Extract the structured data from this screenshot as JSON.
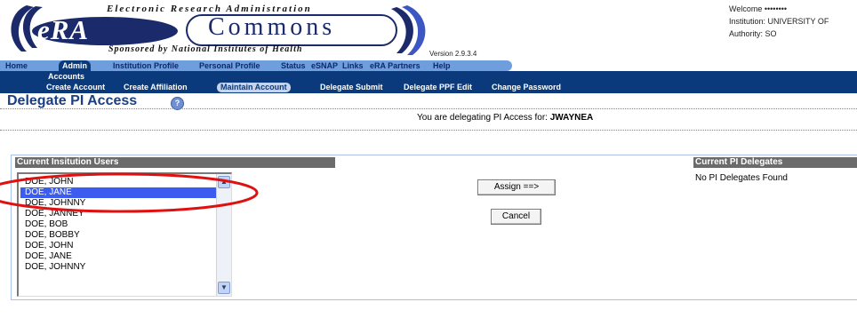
{
  "header": {
    "tagline_top": "Electronic Research Administration",
    "logo_era": "eRA",
    "logo_commons": "Commons",
    "tagline_bottom": "Sponsored by National Institutes of Health",
    "version": "Version 2.9.3.4"
  },
  "user_info": {
    "welcome": "Welcome  ••••••••",
    "institution": "Institution: UNIVERSITY OF",
    "authority": "Authority:  SO"
  },
  "nav": {
    "items": [
      "Home",
      "Admin",
      "Institution Profile",
      "Personal Profile",
      "Status",
      "eSNAP",
      "Links",
      "eRA Partners",
      "Help"
    ],
    "active": "Admin"
  },
  "subnav": {
    "section": "Accounts",
    "items": [
      "Create Account",
      "Create Affiliation",
      "Maintain Account",
      "Delegate Submit",
      "Delegate PPF Edit",
      "Change Password"
    ],
    "active": "Maintain Account"
  },
  "page": {
    "title": "Delegate PI Access",
    "help_glyph": "?",
    "delegating_prefix": "You are delegating PI Access for: ",
    "delegating_user": "JWAYNEA"
  },
  "users_panel": {
    "header": "Current Insitution Users",
    "users": [
      "DOE, JOHN",
      "DOE, JANE",
      "DOE, JOHNNY",
      "DOE, JANNEY",
      "DOE, BOB",
      "DOE, BOBBY",
      "DOE, JOHN",
      "DOE, JANE",
      "DOE, JOHNNY"
    ],
    "selected": "DOE, JANE"
  },
  "actions": {
    "assign_label": "Assign ==>",
    "cancel_label": "Cancel"
  },
  "delegates_panel": {
    "header": "Current PI Delegates",
    "empty_text": "No PI Delegates Found"
  },
  "colors": {
    "nav_blue": "#0b3a7c",
    "tab_light": "#6e9fdc",
    "selection": "#3c5bf0",
    "annotation": "#e01010"
  }
}
